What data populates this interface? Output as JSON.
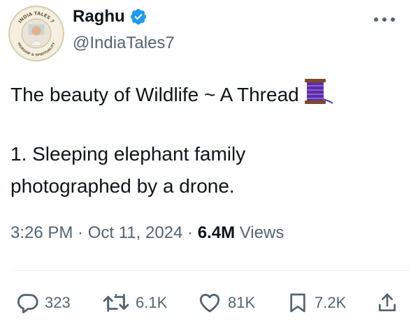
{
  "author": {
    "name": "Raghu",
    "handle": "@IndiaTales7",
    "avatar_text_top": "INDIA TALES 7",
    "avatar_text_bottom": "WORSHIP & SPIRITUALITY"
  },
  "tweet": {
    "line1": "The beauty of Wildlife ~ A Thread",
    "line2": "1. Sleeping elephant family",
    "line3": "photographed by a drone."
  },
  "meta": {
    "time": "3:26 PM",
    "sep1": " · ",
    "date": "Oct 11, 2024",
    "sep2": " · ",
    "views_count": "6.4M",
    "views_label": " Views"
  },
  "actions": {
    "replies": "323",
    "reposts": "6.1K",
    "likes": "81K",
    "bookmarks": "7.2K"
  },
  "colors": {
    "text": "#0f1419",
    "secondary": "#536471",
    "verified": "#1d9bf0",
    "divider": "#eff3f4"
  },
  "icons": [
    "verified-badge-icon",
    "more-icon",
    "spool-emoji-icon",
    "reply-icon",
    "repost-icon",
    "like-icon",
    "bookmark-icon",
    "share-icon"
  ]
}
